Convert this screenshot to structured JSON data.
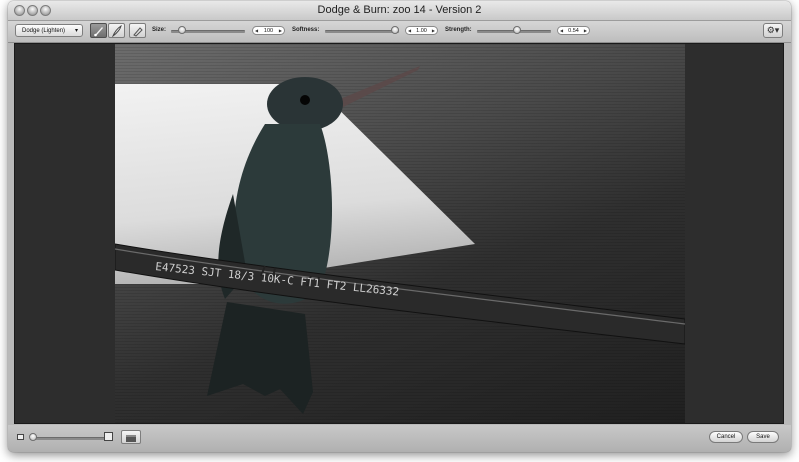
{
  "window": {
    "title": "Dodge & Burn: zoo 14 - Version 2"
  },
  "toolbar": {
    "mode_select": {
      "selected": "Dodge (Lighten)"
    },
    "tools": [
      {
        "name": "brush",
        "icon": "brush-icon",
        "active": true
      },
      {
        "name": "feather",
        "icon": "feather-icon",
        "active": false
      },
      {
        "name": "eraser",
        "icon": "eraser-icon",
        "active": false
      }
    ],
    "size": {
      "label": "Size:",
      "value": "100",
      "level": 0.1
    },
    "softness": {
      "label": "Softness:",
      "value": "1.00",
      "level": 1.0
    },
    "strength": {
      "label": "Strength:",
      "value": "0.54",
      "level": 0.54
    },
    "action_menu_icon": "gear-icon"
  },
  "photo": {
    "description_icon": "hummingbird-photo",
    "cable_text": "E47523 SJT 18/3 10K-C FT1 FT2 LL26332"
  },
  "bottom": {
    "zoom_level": 0.05,
    "cancel_label": "Cancel",
    "save_label": "Save"
  },
  "colors": {
    "canvas": "#2d2d2d",
    "chrome": "#b9b9b9"
  }
}
